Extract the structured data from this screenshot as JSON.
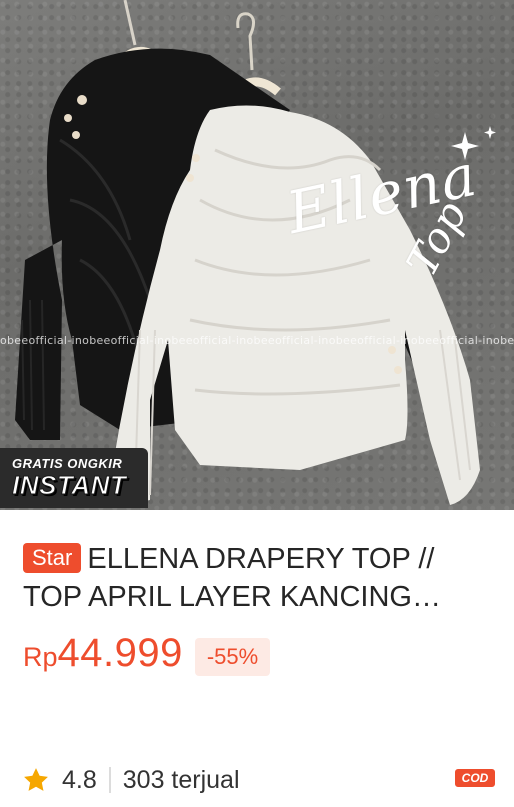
{
  "product": {
    "image": {
      "overlay_script_line1": "Ellena",
      "overlay_script_line2": "Top",
      "watermark": "obeeofficial-inobeeofficial-inobeeofficial-inobeeofficial-inobeeofficial-inobeeofficial-inobeeofficial",
      "shipping_badge": {
        "line1": "GRATIS ONGKIR",
        "line2": "INSTANT"
      }
    },
    "badge": "Star",
    "title": "ELLENA DRAPERY TOP // TOP APRIL LAYER KANCING VIRAL",
    "price": {
      "currency": "Rp",
      "amount": "44.999"
    },
    "discount": "-55%",
    "rating": "4.8",
    "sold": "303 terjual",
    "cod_label": "COD",
    "icons": {
      "rating": "star-icon"
    },
    "colors": {
      "accent": "#ee4d2d",
      "discount_bg": "#fdeae4",
      "star": "#f6a700"
    }
  }
}
